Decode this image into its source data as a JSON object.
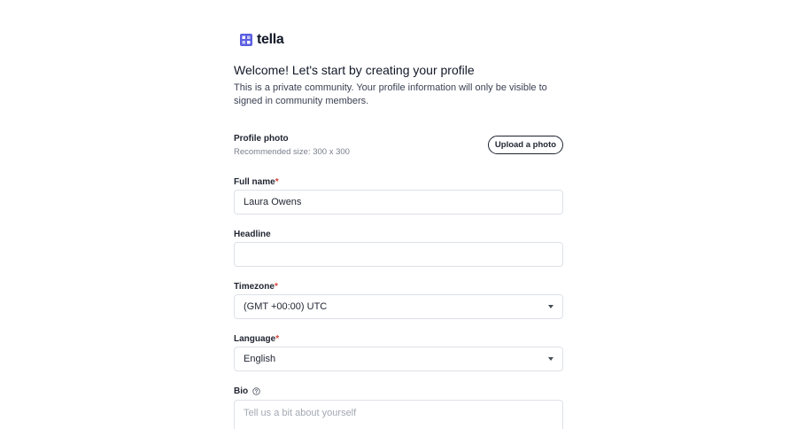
{
  "brand": {
    "name": "tella",
    "colors": {
      "logo_primary": "#5b5fe0",
      "logo_secondary": "#a3a6f0"
    }
  },
  "page": {
    "title": "Welcome! Let's start by creating your profile",
    "description": "This is a private community. Your profile information will only be visible to signed in community members."
  },
  "profile_photo": {
    "label": "Profile photo",
    "hint": "Recommended size: 300 x 300",
    "upload_label": "Upload a photo"
  },
  "fields": {
    "full_name": {
      "label": "Full name",
      "required_mark": "*",
      "value": "Laura Owens"
    },
    "headline": {
      "label": "Headline",
      "value": ""
    },
    "timezone": {
      "label": "Timezone",
      "required_mark": "*",
      "value": "(GMT +00:00) UTC"
    },
    "language": {
      "label": "Language",
      "required_mark": "*",
      "value": "English"
    },
    "bio": {
      "label": "Bio",
      "placeholder": "Tell us a bit about yourself",
      "icon": "info-icon"
    }
  },
  "colors": {
    "required": "#d9423b",
    "border": "#dde1e7",
    "text": "#1f2430",
    "muted": "#7a7f8c"
  }
}
